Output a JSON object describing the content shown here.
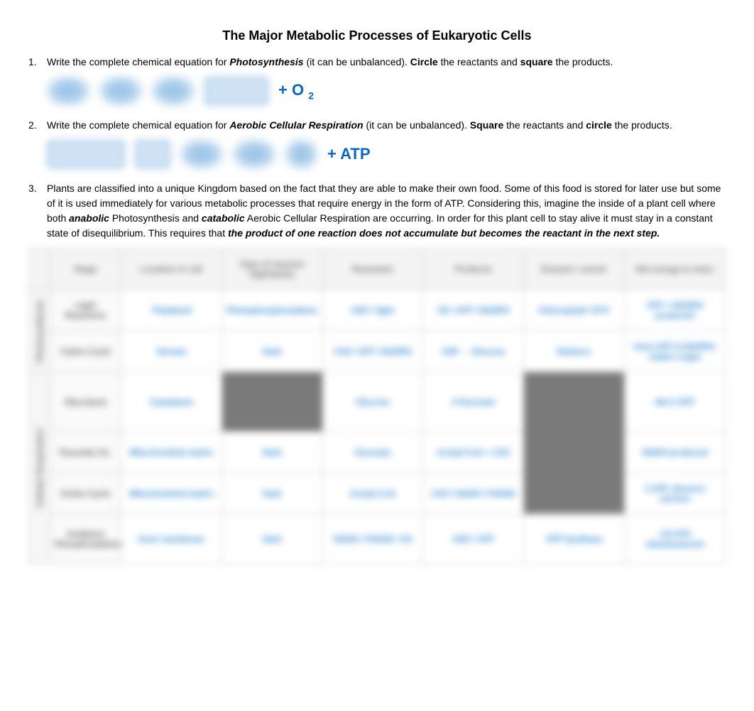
{
  "title": "The Major Metabolic Processes of Eukaryotic Cells",
  "q1": {
    "num": "1.",
    "pre": "Write the complete chemical equation for ",
    "term": "Photosynthesis",
    "mid": " (it can be unbalanced).  ",
    "circle": "Circle",
    "mid2": " the reactants and ",
    "square": "square",
    "post": "  the products.",
    "eq_tail": "+ O",
    "eq_sub": "2"
  },
  "q2": {
    "num": "2.",
    "pre": "Write the complete chemical equation for ",
    "term": "Aerobic Cellular Respiration",
    "mid": " (it can be unbalanced).  ",
    "square": "Square",
    "mid2": " the reactants and ",
    "circle": "circle",
    "post": " the products.",
    "eq_tail": "+ ATP"
  },
  "q3": {
    "num": "3.",
    "p1": "Plants are classified into a unique Kingdom based on the fact that they are able to make their own food.   Some of this food is stored for later use but some of it is used immediately for various metabolic processes that require energy in the form of ATP.  Considering this, imagine the inside of a plant cell where both ",
    "anabolic": "anabolic",
    "p2": " Photosynthesis and ",
    "catabolic": "catabolic",
    "p3": " Aerobic Cellular Respiration are occurring.  In order for this plant cell to stay alive it must stay in a constant state of disequilibrium.  This requires that ",
    "emph": "the product of one reaction does not accumulate but becomes the reactant in the next step."
  },
  "table": {
    "headers": [
      "",
      "",
      "Stage",
      "Location in cell",
      "Type of reaction (light/dark)",
      "Reactants",
      "Products",
      "Enzyme / carrier",
      "Net energy & notes"
    ],
    "side1": "Photosynthesis",
    "side2": "Cellular Respiration",
    "rows": [
      {
        "label": "Light Reactions",
        "cells": [
          "Thylakoid",
          "Photophosphorylation",
          "H2O / light",
          "O2 / ATP / NADPH",
          "Chlorophyll / ETC",
          "ATP + NADPH produced"
        ]
      },
      {
        "label": "Calvin Cycle",
        "cells": [
          "Stroma",
          "Dark",
          "CO2 / ATP / NADPH",
          "G3P → Glucose",
          "Rubisco",
          "Uses ATP & NADPH; makes sugar"
        ]
      },
      {
        "label": "Glycolysis",
        "cells": [
          "Cytoplasm",
          "",
          "Glucose",
          "2 Pyruvate",
          "",
          "Net 2 ATP"
        ]
      },
      {
        "label": "Pyruvate Ox.",
        "cells": [
          "Mitochondrial matrix",
          "Dark",
          "Pyruvate",
          "Acetyl-CoA + CO2",
          "",
          "NADH produced"
        ]
      },
      {
        "label": "Krebs Cycle",
        "cells": [
          "Mitochondrial matrix",
          "Dark",
          "Acetyl-CoA",
          "CO2 / NADH / FADH2",
          "",
          "2 ATP, electron carriers"
        ]
      },
      {
        "label": "Oxidative Phosphorylation",
        "cells": [
          "Inner membrane",
          "Dark",
          "NADH / FADH2 / O2",
          "H2O / ATP",
          "ATP Synthase",
          "~34 ATP; chemiosmosis"
        ]
      }
    ]
  }
}
